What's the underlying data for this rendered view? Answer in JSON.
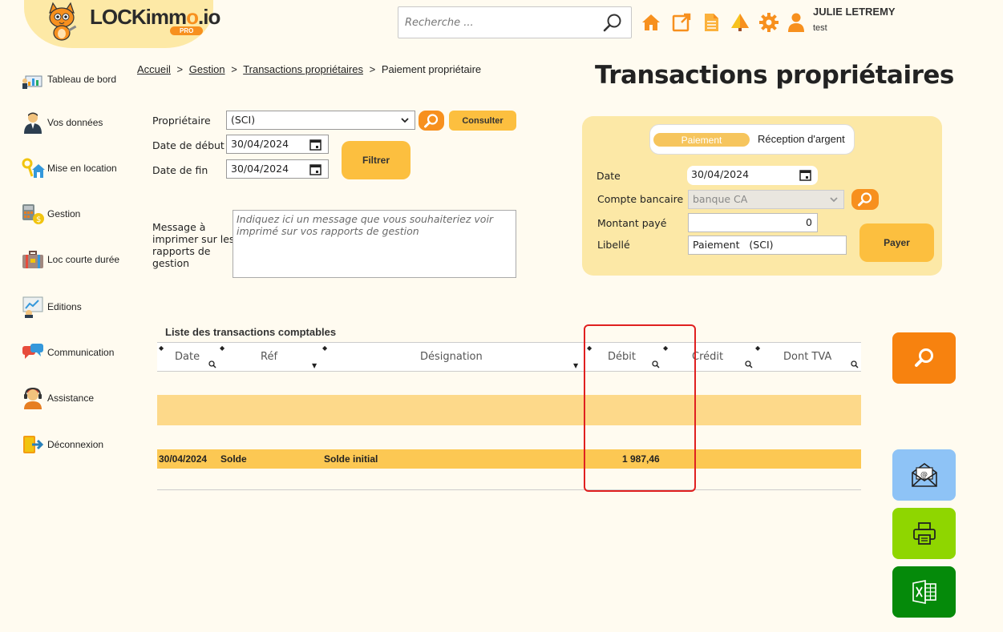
{
  "app": {
    "logo_prefix": "LOCKimm",
    "logo_o": "o",
    "logo_suffix": ".io",
    "logo_badge": "PRO"
  },
  "header": {
    "search_placeholder": "Recherche ...",
    "user_name": "JULIE LETREMY",
    "user_role": "test",
    "icons": [
      "home-icon",
      "external-link-icon",
      "document-icon",
      "tree-icon",
      "gear-icon",
      "user-icon"
    ],
    "accent": "#f7901e"
  },
  "sidebar": {
    "items": [
      {
        "label": "Tableau de bord",
        "icon": "dashboard-icon"
      },
      {
        "label": "Vos données",
        "icon": "person-icon"
      },
      {
        "label": "Mise en location",
        "icon": "keys-house-icon"
      },
      {
        "label": "Gestion",
        "icon": "calculator-icon"
      },
      {
        "label": "Loc courte durée",
        "icon": "suitcase-icon"
      },
      {
        "label": "Editions",
        "icon": "report-icon"
      },
      {
        "label": "Communication",
        "icon": "chat-icon"
      },
      {
        "label": "Assistance",
        "icon": "headset-icon"
      },
      {
        "label": "Déconnexion",
        "icon": "logout-icon"
      }
    ]
  },
  "breadcrumb": {
    "home": "Accueil",
    "gestion": "Gestion",
    "transactions": "Transactions propriétaires",
    "current": "Paiement propriétaire",
    "sep": ">"
  },
  "page": {
    "title": "Transactions propriétaires"
  },
  "filter": {
    "owner_label": "Propriétaire",
    "owner_value": "(SCI)",
    "consult_label": "Consulter",
    "start_label": "Date de début",
    "start_value": "30/04/2024",
    "end_label": "Date de fin",
    "end_value": "30/04/2024",
    "filter_label": "Filtrer",
    "message_label_1": "Message à",
    "message_label_2": "imprimer sur les",
    "message_label_3": "rapports de",
    "message_label_4": "gestion",
    "message_placeholder": "Indiquez ici un message que vous souhaiteriez voir imprimé sur vos rapports de gestion"
  },
  "payment": {
    "tab_pay": "Paiement",
    "tab_recv": "Réception d'argent",
    "date_label": "Date",
    "date_value": "30/04/2024",
    "account_label": "Compte bancaire",
    "account_value": "banque CA",
    "amount_label": "Montant payé",
    "amount_value": "0",
    "libelle_label": "Libellé",
    "libelle_value": "Paiement   (SCI)",
    "pay_button": "Payer"
  },
  "table": {
    "title": "Liste des transactions comptables",
    "columns": [
      "Date",
      "Réf",
      "Désignation",
      "Débit",
      "Crédit",
      "Dont TVA"
    ],
    "rows": [
      {
        "date": "30/04/2024",
        "ref": "Solde",
        "designation": "Solde initial",
        "debit": "1 987,46",
        "credit": "",
        "tva": ""
      }
    ]
  },
  "actions": {
    "search": "search-icon",
    "email": "email-icon",
    "print": "printer-icon",
    "excel": "excel-icon"
  }
}
